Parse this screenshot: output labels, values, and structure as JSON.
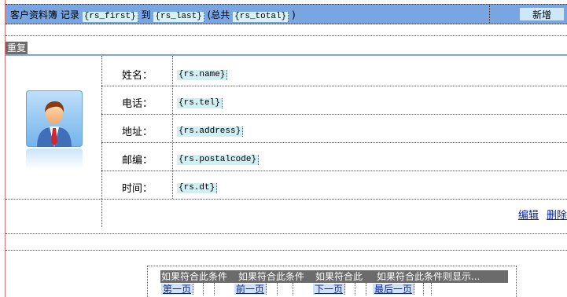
{
  "header": {
    "title": "客户资料簿",
    "record_label": "记录",
    "first_placeholder": "{rs_first}",
    "to_label": "到",
    "last_placeholder": "{rs_last}",
    "total_prefix": "(总共",
    "total_placeholder": "{rs_total}",
    "total_suffix": ")",
    "add_button_label": "新增"
  },
  "repeat_label": "重复",
  "record": {
    "fields": [
      {
        "label": "姓名：",
        "value": "{rs.name}"
      },
      {
        "label": "电话：",
        "value": "{rs.tel}"
      },
      {
        "label": "地址：",
        "value": "{rs.address}"
      },
      {
        "label": "邮编：",
        "value": "{rs.postalcode}"
      },
      {
        "label": "时间：",
        "value": "{rs.dt}"
      }
    ],
    "edit_label": "编辑",
    "delete_label": "删除"
  },
  "pager": {
    "conditions": [
      "如果符合此条件",
      "如果符合此条件",
      "如果符合此",
      "如果符合此条件则显示..."
    ],
    "first_page": "第一页",
    "prev_page": "前一页",
    "next_page": "下一页",
    "last_page": "最后一页"
  },
  "colors": {
    "header_bg": "#79a6e3",
    "placeholder_bg": "#cfeff3",
    "repeat_tag_bg": "#6b6b6b",
    "link": "#0a1fa0",
    "left_guide": "#e36d6d"
  }
}
